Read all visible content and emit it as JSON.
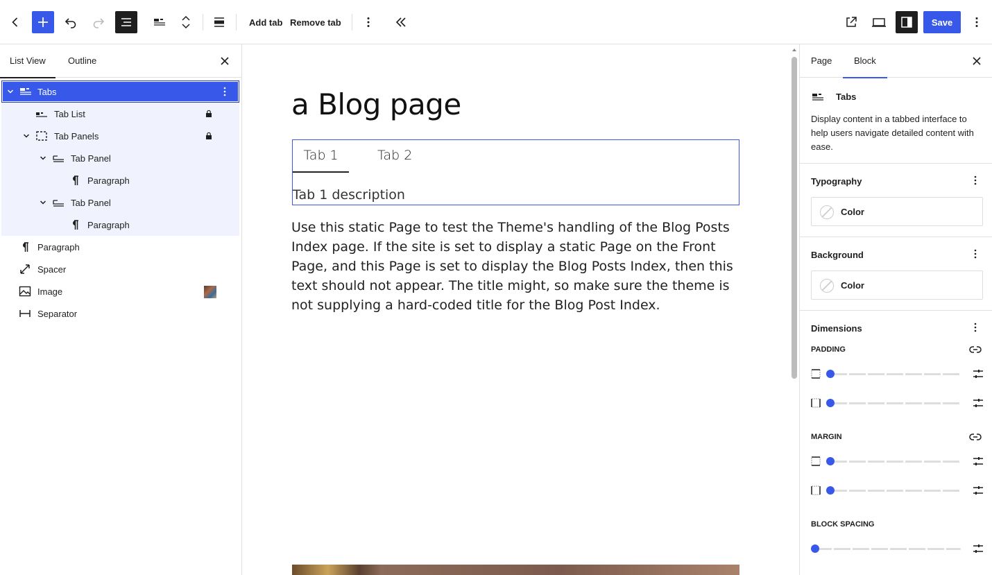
{
  "toolbar": {
    "add_tab_label": "Add tab",
    "remove_tab_label": "Remove tab",
    "save_label": "Save",
    "accent_color": "#3858e9"
  },
  "left_panel": {
    "tabs": [
      {
        "label": "List View"
      },
      {
        "label": "Outline"
      }
    ],
    "tree": [
      {
        "label": "Tabs"
      },
      {
        "label": "Tab List"
      },
      {
        "label": "Tab Panels"
      },
      {
        "label": "Tab Panel"
      },
      {
        "label": "Paragraph"
      },
      {
        "label": "Tab Panel"
      },
      {
        "label": "Paragraph"
      },
      {
        "label": "Paragraph"
      },
      {
        "label": "Spacer"
      },
      {
        "label": "Image"
      },
      {
        "label": "Separator"
      }
    ]
  },
  "canvas": {
    "page_title": "a Blog page",
    "tabs": [
      {
        "label": "Tab 1"
      },
      {
        "label": "Tab 2"
      }
    ],
    "tab_description": "Tab 1 description",
    "body_text": "Use this static Page to test the Theme's handling of the Blog Posts Index page. If the site is set to display a static Page on the Front Page, and this Page is set to display the Blog Posts Index, then this text should not appear. The title might, so make sure the theme is not supplying a hard-coded title for the Blog Post Index."
  },
  "right_panel": {
    "tabs": [
      {
        "label": "Page"
      },
      {
        "label": "Block"
      }
    ],
    "block": {
      "name": "Tabs",
      "description": "Display content in a tabbed interface to help users navigate detailed content with ease."
    },
    "typography": {
      "title": "Typography",
      "color_label": "Color"
    },
    "background": {
      "title": "Background",
      "color_label": "Color"
    },
    "dimensions": {
      "title": "Dimensions",
      "padding_label": "PADDING",
      "margin_label": "MARGIN",
      "block_spacing_label": "BLOCK SPACING"
    }
  }
}
